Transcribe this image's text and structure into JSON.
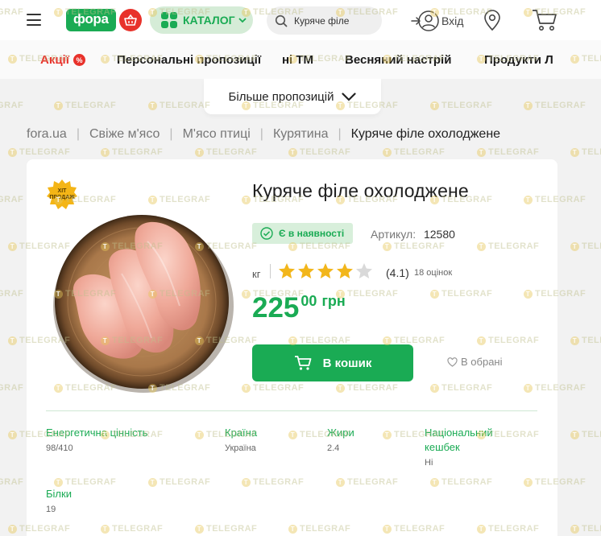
{
  "header": {
    "logo_text": "фора",
    "catalog_label": "КАТАЛОГ",
    "search_value": "Куряче філе",
    "login_label": "Вхід"
  },
  "promo": {
    "items": [
      "Акції",
      "Персональні пропозиції",
      "ні ТМ",
      "Весняний настрій",
      "Продукти Л"
    ],
    "more_label": "Більше пропозицій"
  },
  "breadcrumb": [
    "fora.ua",
    "Свіже м'ясо",
    "М'ясо птиці",
    "Курятина",
    "Куряче філе охолоджене"
  ],
  "product": {
    "badge_text": "ХІТ ПРОДАЖ",
    "title": "Куряче філе охолоджене",
    "stock_label": "Є в наявності",
    "article_label": "Артикул:",
    "article_number": "12580",
    "unit": "кг",
    "rating_value": 4.1,
    "rating_text": "(4.1)",
    "reviews_text": "18 оцінок",
    "price_int": "225",
    "price_dec": "00",
    "currency": "грн",
    "buy_label": "В кошик",
    "favorite_label": "В обрані"
  },
  "attributes": [
    {
      "name": "Енергетична цінність",
      "value": "98/410"
    },
    {
      "name": "Країна",
      "value": "Україна"
    },
    {
      "name": "Жири",
      "value": "2.4"
    },
    {
      "name": "Національний кешбек",
      "value": "Ні"
    },
    {
      "name": "Білки",
      "value": "19"
    }
  ],
  "watermark": "TELEGRAF",
  "colors": {
    "brand_green": "#1aab54",
    "accent_red": "#e8322b",
    "star_gold": "#f2b61b"
  }
}
